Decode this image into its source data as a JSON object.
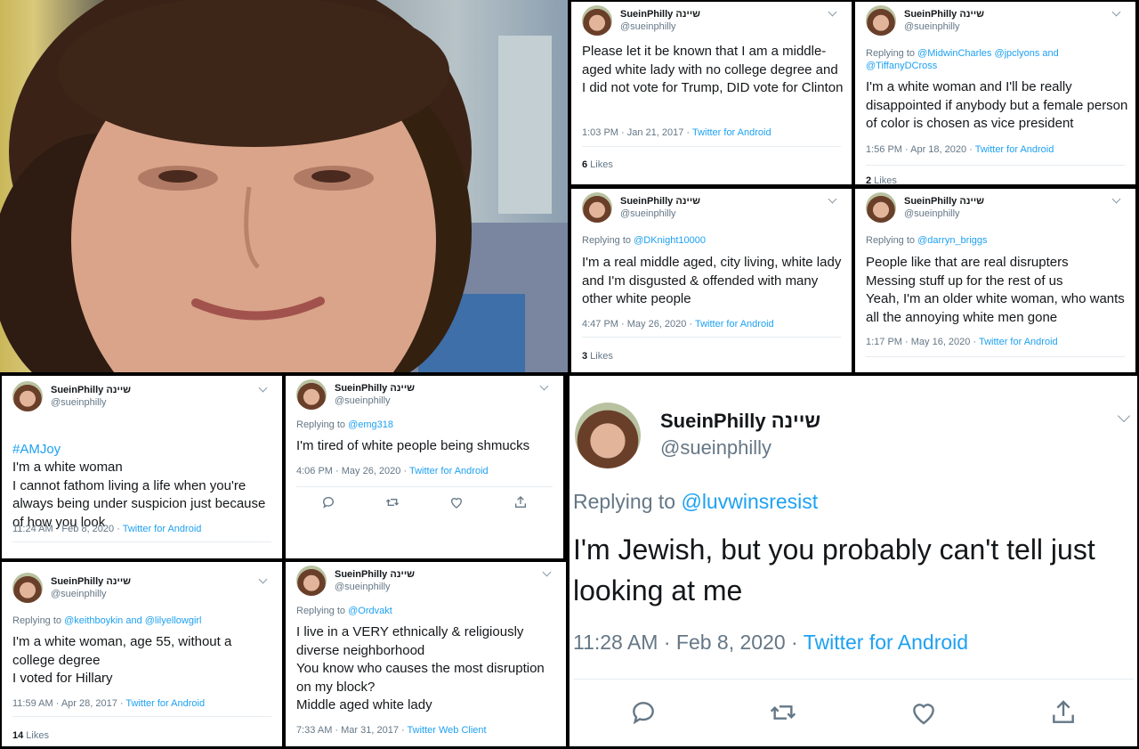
{
  "user": {
    "display_name": "SueinPhilly שיינה",
    "handle": "@sueinphilly"
  },
  "tweets": [
    {
      "text": "Please let it be known that I am a middle-aged white lady with no college degree and I did not vote for Trump, DID vote for Clinton",
      "time": "1:03 PM · Jan 21, 2017 · ",
      "source": "Twitter for Android",
      "likes_count": "6",
      "likes_label": " Likes"
    },
    {
      "replying_prefix": "Replying to ",
      "replying_to": "@MidwinCharles @jpclyons and @TiffanyDCross",
      "text": "I'm a white woman and I'll be really disappointed if anybody but a female person of color is chosen as vice president",
      "time": "1:56 PM · Apr 18, 2020 · ",
      "source": "Twitter for Android",
      "likes_count": "2",
      "likes_label": " Likes"
    },
    {
      "replying_prefix": "Replying to ",
      "replying_to": "@DKnight10000",
      "text": "I'm a real middle aged, city living, white lady and I'm disgusted & offended with many other white people",
      "time": "4:47 PM · May 26, 2020 · ",
      "source": "Twitter for Android",
      "likes_count": "3",
      "likes_label": " Likes"
    },
    {
      "replying_prefix": "Replying to ",
      "replying_to": "@darryn_briggs",
      "text": "People like that are real disrupters\nMessing stuff up for the rest of us\nYeah, I'm an older white woman, who wants all the annoying white men gone",
      "time": "1:17 PM · May 16, 2020 · ",
      "source": "Twitter for Android"
    },
    {
      "hashtag": "#AMJoy",
      "text": "I'm a white woman\nI cannot fathom living a life when you're always being under suspicion just because of how you look",
      "time": "11:24 AM · Feb 8, 2020 · ",
      "source": "Twitter for Android"
    },
    {
      "replying_prefix": "Replying to ",
      "replying_to": "@emg318",
      "text": "I'm tired of white people being shmucks",
      "time": "4:06 PM · May 26, 2020 · ",
      "source": "Twitter for Android"
    },
    {
      "replying_prefix": "Replying to ",
      "replying_to": "@keithboykin and @lilyellowgirl",
      "text": "I'm a white woman, age 55, without a college degree\nI voted for Hillary",
      "time": "11:59 AM · Apr 28, 2017 · ",
      "source": "Twitter for Android",
      "likes_count": "14",
      "likes_label": " Likes"
    },
    {
      "replying_prefix": "Replying to ",
      "replying_to": "@Ordvakt",
      "text": "I live in a VERY ethnically & religiously diverse neighborhood\nYou know who causes the most disruption on my block?\nMiddle aged white lady",
      "time": "7:33 AM · Mar 31, 2017 · ",
      "source": "Twitter Web Client"
    },
    {
      "replying_prefix": "Replying to ",
      "replying_to": "@luvwinsresist",
      "text": "I'm Jewish, but you probably can't tell just looking at me",
      "time": "11:28 AM · Feb 8, 2020 · ",
      "source": "Twitter for Android"
    }
  ]
}
